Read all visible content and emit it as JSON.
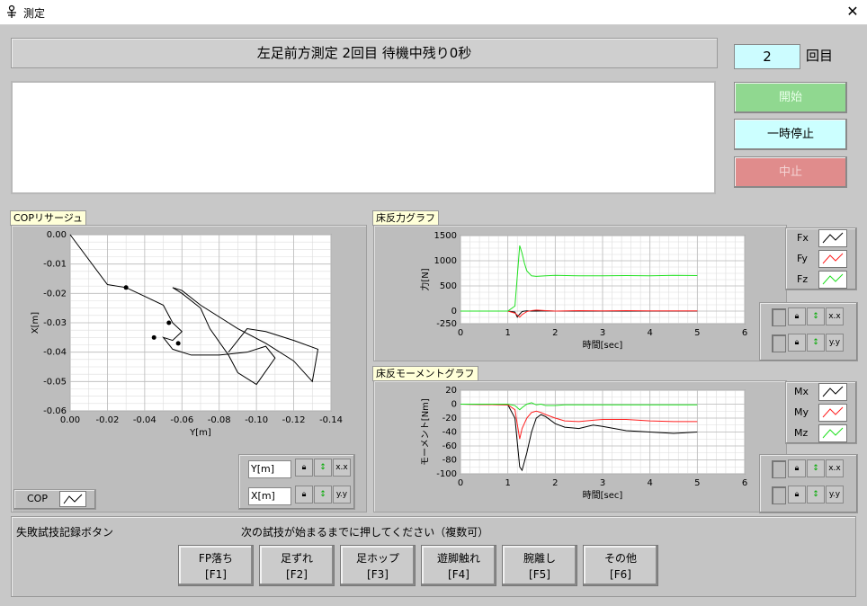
{
  "window": {
    "title": "測定",
    "close_label": "✕"
  },
  "status": {
    "text": "左足前方測定 2回目  待機中残り0秒"
  },
  "counter": {
    "value": "2",
    "unit": "回目"
  },
  "buttons": {
    "start": "開始",
    "pause": "一時停止",
    "stop": "中止"
  },
  "cop_graph": {
    "label": "COPリサージュ",
    "legend": "COP",
    "axis_fields": [
      "Y[m]",
      "X[m]"
    ]
  },
  "force_graph": {
    "label": "床反力グラフ",
    "legend": [
      "Fx",
      "Fy",
      "Fz"
    ]
  },
  "moment_graph": {
    "label": "床反モーメントグラフ",
    "legend": [
      "Mx",
      "My",
      "Mz"
    ]
  },
  "toolbar_icons": [
    "lock-icon",
    "autoscale-x-icon",
    "format-x-icon",
    "lock-icon",
    "autoscale-y-icon",
    "format-y-icon"
  ],
  "fail_panel": {
    "title": "失敗試技記録ボタン",
    "instruction": "次の試技が始まるまでに押してください（複数可）",
    "buttons": [
      {
        "label": "FP落ち",
        "key": "[F1]"
      },
      {
        "label": "足ずれ",
        "key": "[F2]"
      },
      {
        "label": "足ホップ",
        "key": "[F3]"
      },
      {
        "label": "遊脚触れ",
        "key": "[F4]"
      },
      {
        "label": "腕離し",
        "key": "[F5]"
      },
      {
        "label": "その他",
        "key": "[F6]"
      }
    ]
  },
  "colors": {
    "fx": "#000000",
    "fy": "#ff2020",
    "fz": "#20e020"
  },
  "chart_data": [
    {
      "type": "scatter",
      "title": "COPリサージュ",
      "xlabel": "Y[m]",
      "ylabel": "X[m]",
      "xlim": [
        0.0,
        -0.14
      ],
      "ylim": [
        -0.06,
        0.0
      ],
      "xticks": [
        "0.00",
        "-0.02",
        "-0.04",
        "-0.06",
        "-0.08",
        "-0.10",
        "-0.12",
        "-0.14"
      ],
      "yticks": [
        "0.00",
        "-0.01",
        "-0.02",
        "-0.03",
        "-0.04",
        "-0.05",
        "-0.06"
      ],
      "grid": true,
      "series": [
        {
          "name": "COP",
          "x": [
            0.0,
            -0.02,
            -0.03,
            -0.04,
            -0.05,
            -0.055,
            -0.06,
            -0.055,
            -0.05,
            -0.055,
            -0.065,
            -0.08,
            -0.095,
            -0.105,
            -0.11,
            -0.1,
            -0.09,
            -0.085,
            -0.075,
            -0.07,
            -0.06,
            -0.055,
            -0.06,
            -0.07,
            -0.09,
            -0.105,
            -0.12,
            -0.13,
            -0.133,
            -0.12,
            -0.105,
            -0.095,
            -0.09,
            -0.085
          ],
          "y": [
            0.0,
            -0.017,
            -0.018,
            -0.021,
            -0.024,
            -0.03,
            -0.033,
            -0.036,
            -0.035,
            -0.039,
            -0.041,
            -0.041,
            -0.04,
            -0.038,
            -0.042,
            -0.051,
            -0.047,
            -0.041,
            -0.032,
            -0.025,
            -0.02,
            -0.018,
            -0.019,
            -0.024,
            -0.032,
            -0.037,
            -0.043,
            -0.05,
            -0.039,
            -0.036,
            -0.033,
            -0.032,
            -0.036,
            -0.04
          ]
        }
      ]
    },
    {
      "type": "line",
      "title": "床反力グラフ",
      "xlabel": "時間[sec]",
      "ylabel": "力[N]",
      "xlim": [
        0,
        6
      ],
      "ylim": [
        -250,
        1500
      ],
      "xticks": [
        "0",
        "1",
        "2",
        "3",
        "4",
        "5",
        "6"
      ],
      "yticks": [
        "1500",
        "1000",
        "500",
        "0",
        "-250"
      ],
      "grid": true,
      "x": [
        0,
        1,
        1.15,
        1.2,
        1.25,
        1.3,
        1.35,
        1.4,
        1.5,
        1.6,
        1.8,
        2,
        2.5,
        3,
        3.5,
        4,
        4.5,
        5
      ],
      "series": [
        {
          "name": "Fx",
          "values": [
            0,
            0,
            -20,
            -120,
            -60,
            -10,
            0,
            5,
            0,
            0,
            5,
            0,
            0,
            0,
            0,
            0,
            0,
            0
          ]
        },
        {
          "name": "Fy",
          "values": [
            0,
            0,
            -40,
            -80,
            -120,
            -70,
            -40,
            -10,
            10,
            20,
            10,
            0,
            10,
            5,
            10,
            5,
            5,
            5
          ]
        },
        {
          "name": "Fz",
          "values": [
            0,
            0,
            100,
            700,
            1300,
            1150,
            950,
            800,
            700,
            690,
            700,
            710,
            700,
            700,
            705,
            700,
            710,
            705
          ]
        }
      ]
    },
    {
      "type": "line",
      "title": "床反モーメントグラフ",
      "xlabel": "時間[sec]",
      "ylabel": "モーメント[Nm]",
      "xlim": [
        0,
        6
      ],
      "ylim": [
        -100,
        20
      ],
      "xticks": [
        "0",
        "1",
        "2",
        "3",
        "4",
        "5",
        "6"
      ],
      "yticks": [
        "20",
        "0",
        "-20",
        "-40",
        "-60",
        "-80",
        "-100"
      ],
      "grid": true,
      "x": [
        0,
        1,
        1.15,
        1.25,
        1.3,
        1.4,
        1.5,
        1.6,
        1.7,
        1.8,
        2,
        2.2,
        2.5,
        2.8,
        3,
        3.5,
        4,
        4.5,
        5
      ],
      "series": [
        {
          "name": "Mx",
          "values": [
            0,
            -1,
            -20,
            -90,
            -95,
            -70,
            -40,
            -20,
            -15,
            -18,
            -28,
            -33,
            -35,
            -30,
            -32,
            -38,
            -40,
            -42,
            -40
          ]
        },
        {
          "name": "My",
          "values": [
            0,
            -1,
            -8,
            -50,
            -35,
            -20,
            -12,
            -10,
            -12,
            -15,
            -20,
            -24,
            -25,
            -23,
            -22,
            -22,
            -24,
            -25,
            -25
          ]
        },
        {
          "name": "Mz",
          "values": [
            0,
            0,
            -2,
            -8,
            -5,
            0,
            2,
            -1,
            0,
            -2,
            -2,
            -1,
            -1,
            -1,
            -1,
            -1,
            -1,
            -1,
            -1
          ]
        }
      ]
    }
  ]
}
